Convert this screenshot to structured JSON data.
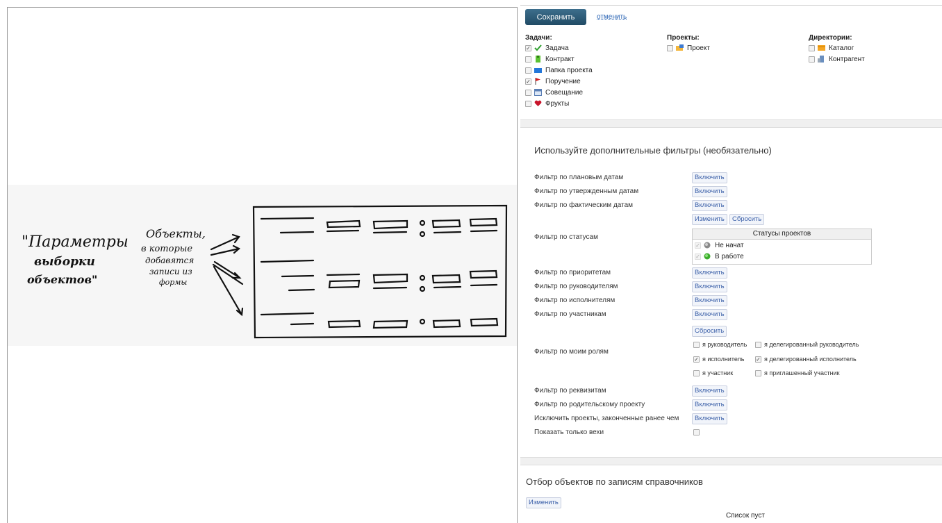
{
  "toolbar": {
    "save_label": "Сохранить",
    "cancel_label": "отменить"
  },
  "sketch": {
    "left_text": "\"Параметры выборки объектов\"",
    "middle_text": "Объекты, в которые добавятся записи из формы"
  },
  "types": {
    "tasks": {
      "title": "Задачи:",
      "items": [
        {
          "label": "Задача",
          "checked": true,
          "icon": "checkmark-icon"
        },
        {
          "label": "Контракт",
          "checked": false,
          "icon": "contract-icon"
        },
        {
          "label": "Папка проекта",
          "checked": false,
          "icon": "folder-icon"
        },
        {
          "label": "Поручение",
          "checked": true,
          "icon": "flag-icon"
        },
        {
          "label": "Совещание",
          "checked": false,
          "icon": "calendar-icon"
        },
        {
          "label": "Фрукты",
          "checked": false,
          "icon": "heart-icon"
        }
      ]
    },
    "projects": {
      "title": "Проекты:",
      "items": [
        {
          "label": "Проект",
          "checked": false,
          "icon": "project-folder-icon"
        }
      ]
    },
    "directories": {
      "title": "Директории:",
      "items": [
        {
          "label": "Каталог",
          "checked": false,
          "icon": "catalog-icon"
        },
        {
          "label": "Контрагент",
          "checked": false,
          "icon": "contractor-icon"
        }
      ]
    }
  },
  "filters": {
    "title": "Используйте дополнительные фильтры (необязательно)",
    "enable_label": "Включить",
    "change_label": "Изменить",
    "reset_label": "Сбросить",
    "planned": "Фильтр по плановым датам",
    "approved": "Фильтр по утвержденным датам",
    "actual": "Фильтр по фактическим датам",
    "status": "Фильтр по статусам",
    "status_table": {
      "header": "Статусы проектов",
      "items": [
        {
          "label": "Не начат",
          "checked": true,
          "color": "#8a8a8a"
        },
        {
          "label": "В работе",
          "checked": true,
          "color": "#3cae2c"
        }
      ]
    },
    "priority": "Фильтр по приоритетам",
    "managers": "Фильтр по руководителям",
    "executors": "Фильтр по исполнителям",
    "participants": "Фильтр по участникам",
    "my_roles": "Фильтр по моим ролям",
    "roles": [
      {
        "label": "я руководитель",
        "checked": false
      },
      {
        "label": "я делегированный руководитель",
        "checked": false
      },
      {
        "label": "я исполнитель",
        "checked": true
      },
      {
        "label": "я делегированный исполнитель",
        "checked": true
      },
      {
        "label": "я участник",
        "checked": false
      },
      {
        "label": "я приглашенный участник",
        "checked": false
      }
    ],
    "requisites": "Фильтр по реквизитам",
    "parent": "Фильтр по родительскому проекту",
    "exclude": "Исключить проекты, законченные ранее чем",
    "milestones": "Показать только вехи"
  },
  "reference": {
    "title": "Отбор объектов по записям справочников",
    "change_label": "Изменить",
    "empty": "Список пуст"
  }
}
